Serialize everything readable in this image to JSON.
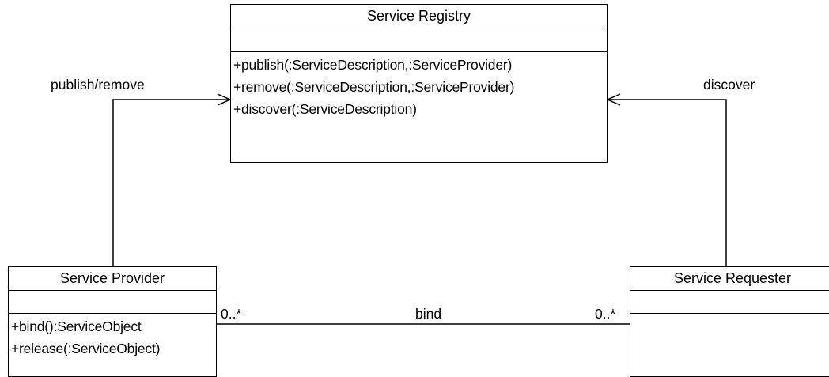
{
  "registry": {
    "name": "Service Registry",
    "operations": [
      "+publish(:ServiceDescription,:ServiceProvider)",
      "+remove(:ServiceDescription,:ServiceProvider)",
      "+discover(:ServiceDescription)"
    ]
  },
  "provider": {
    "name": "Service Provider",
    "operations": [
      "+bind():ServiceObject",
      "+release(:ServiceObject)"
    ]
  },
  "requester": {
    "name": "Service Requester",
    "operations": []
  },
  "associations": {
    "publish_remove_label": "publish/remove",
    "discover_label": "discover",
    "bind_label": "bind",
    "bind_provider_multiplicity": "0..*",
    "bind_requester_multiplicity": "0..*"
  }
}
